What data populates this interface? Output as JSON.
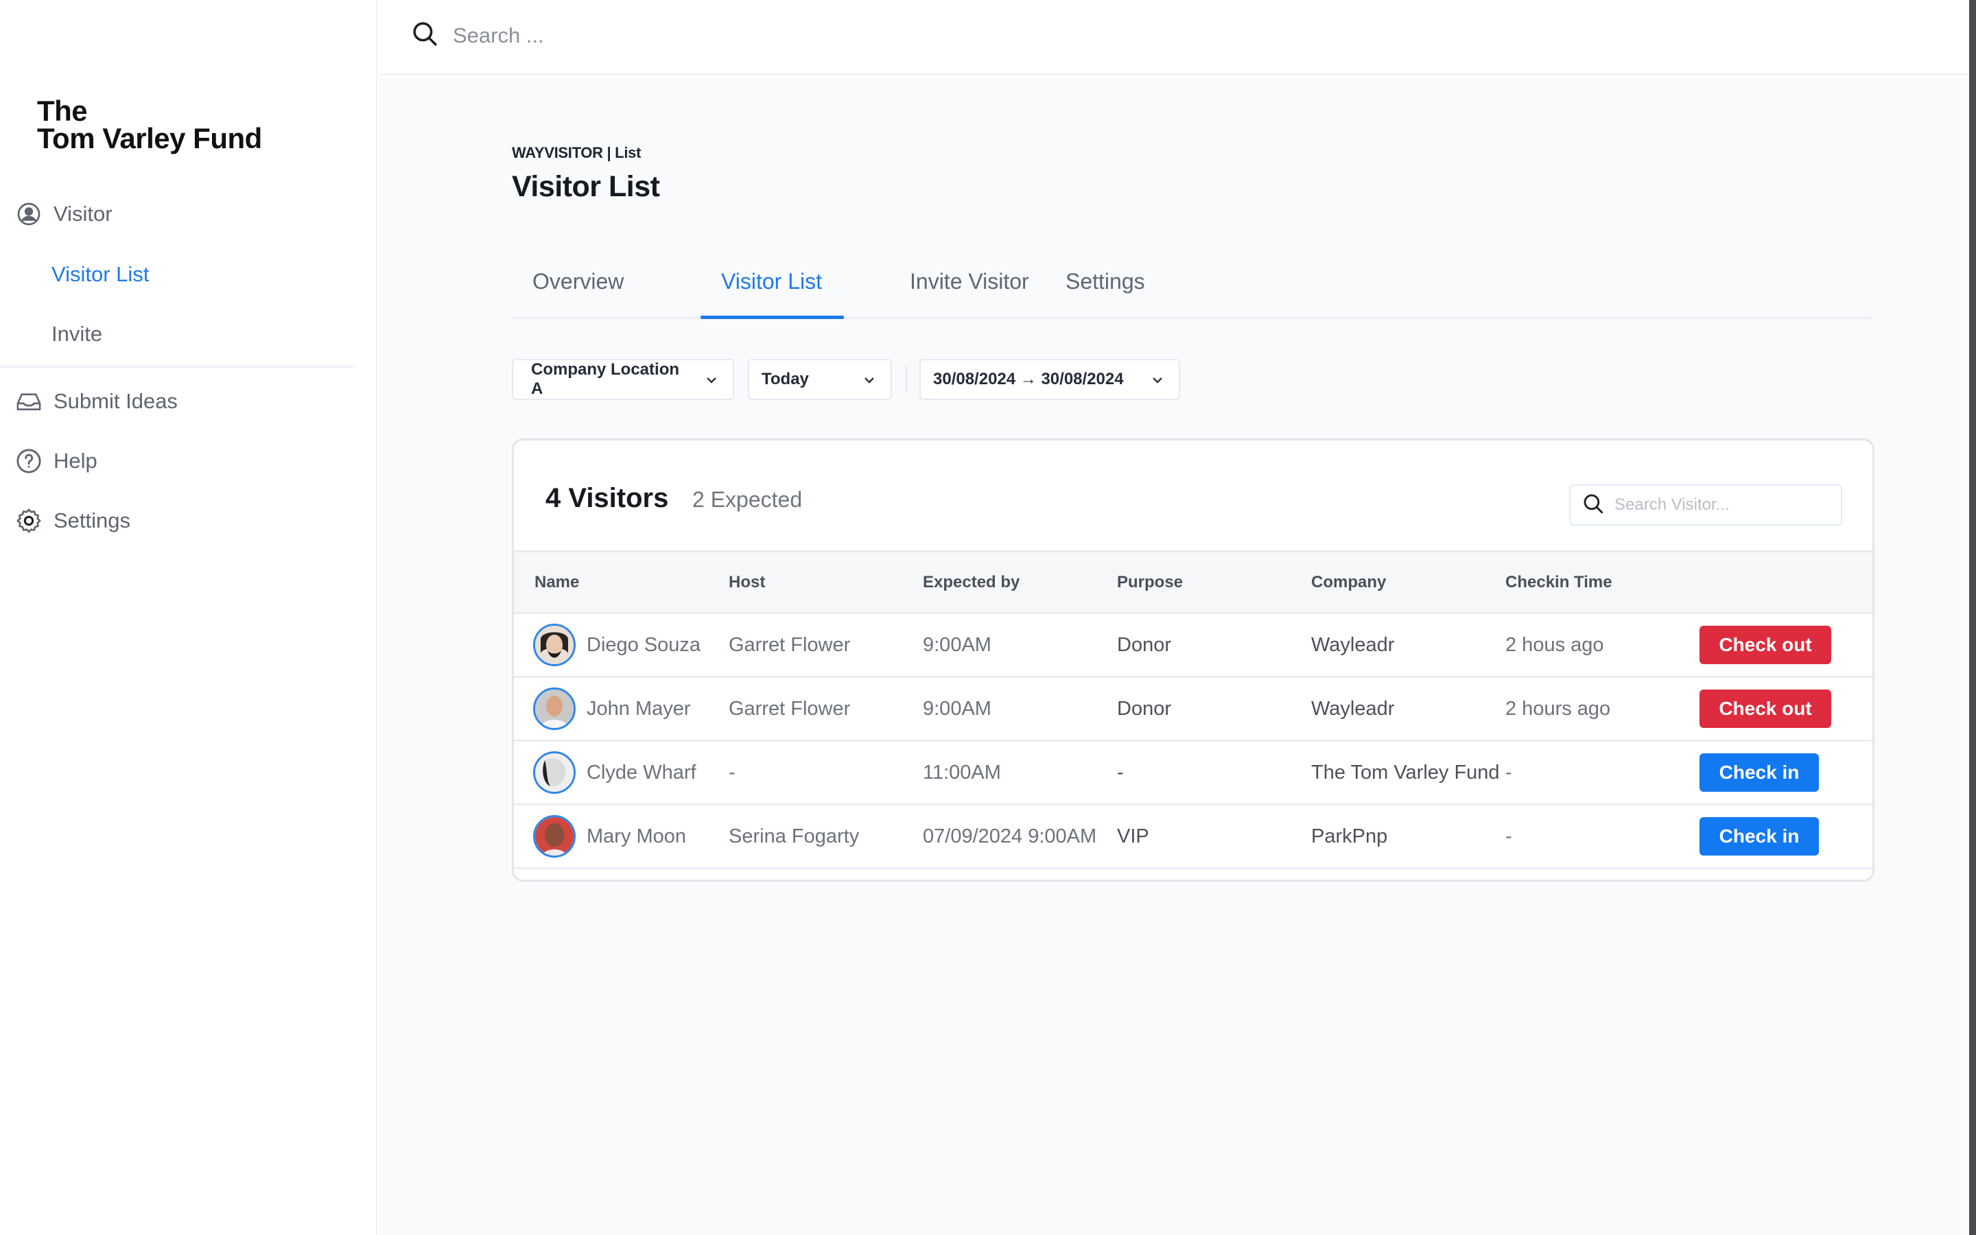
{
  "brand": {
    "line1": "The",
    "line2": "Tom Varley Fund"
  },
  "sidebar": {
    "items": [
      {
        "label": "Visitor",
        "icon": "user-circle-icon"
      },
      {
        "label": "Visitor List",
        "active": true
      },
      {
        "label": "Invite"
      },
      {
        "label": "Submit Ideas",
        "icon": "inbox-icon"
      },
      {
        "label": "Help",
        "icon": "help-circle-icon"
      },
      {
        "label": "Settings",
        "icon": "gear-icon"
      }
    ]
  },
  "topbar": {
    "search_placeholder": "Search ..."
  },
  "page": {
    "breadcrumb": "WAYVISITOR | List",
    "title": "Visitor List",
    "tabs": [
      {
        "label": "Overview"
      },
      {
        "label": "Visitor List",
        "active": true
      },
      {
        "label": "Invite Visitor"
      },
      {
        "label": "Settings"
      }
    ],
    "filters": {
      "location": "Company Location A",
      "range": "Today",
      "dates": "30/08/2024 → 30/08/2024"
    }
  },
  "card": {
    "visitors_count": "4 Visitors",
    "expected_count": "2 Expected",
    "search_placeholder": "Search Visitor...",
    "columns": [
      "Name",
      "Host",
      "Expected by",
      "Purpose",
      "Company",
      "Checkin Time",
      ""
    ],
    "rows": [
      {
        "name": "Diego Souza",
        "host": "Garret Flower",
        "expected_by": "9:00AM",
        "purpose": "Donor",
        "company": "Wayleadr",
        "checkin_time": "2 hous ago",
        "action": "Check out",
        "action_type": "checkout"
      },
      {
        "name": "John Mayer",
        "host": "Garret Flower",
        "expected_by": "9:00AM",
        "purpose": "Donor",
        "company": "Wayleadr",
        "checkin_time": "2 hours ago",
        "action": "Check out",
        "action_type": "checkout"
      },
      {
        "name": "Clyde Wharf",
        "host": "-",
        "expected_by": "11:00AM",
        "purpose": "-",
        "company": "The Tom Varley Fund",
        "checkin_time": "-",
        "action": "Check in",
        "action_type": "checkin"
      },
      {
        "name": "Mary Moon",
        "host": "Serina Fogarty",
        "expected_by": "07/09/2024 9:00AM",
        "purpose": "VIP",
        "company": "ParkPnp",
        "checkin_time": "-",
        "action": "Check in",
        "action_type": "checkin"
      }
    ]
  },
  "colors": {
    "accent": "#1e7ae8",
    "checkout": "#dc2c3d",
    "checkin": "#1379f0",
    "main_bg": "#f9fafc"
  }
}
